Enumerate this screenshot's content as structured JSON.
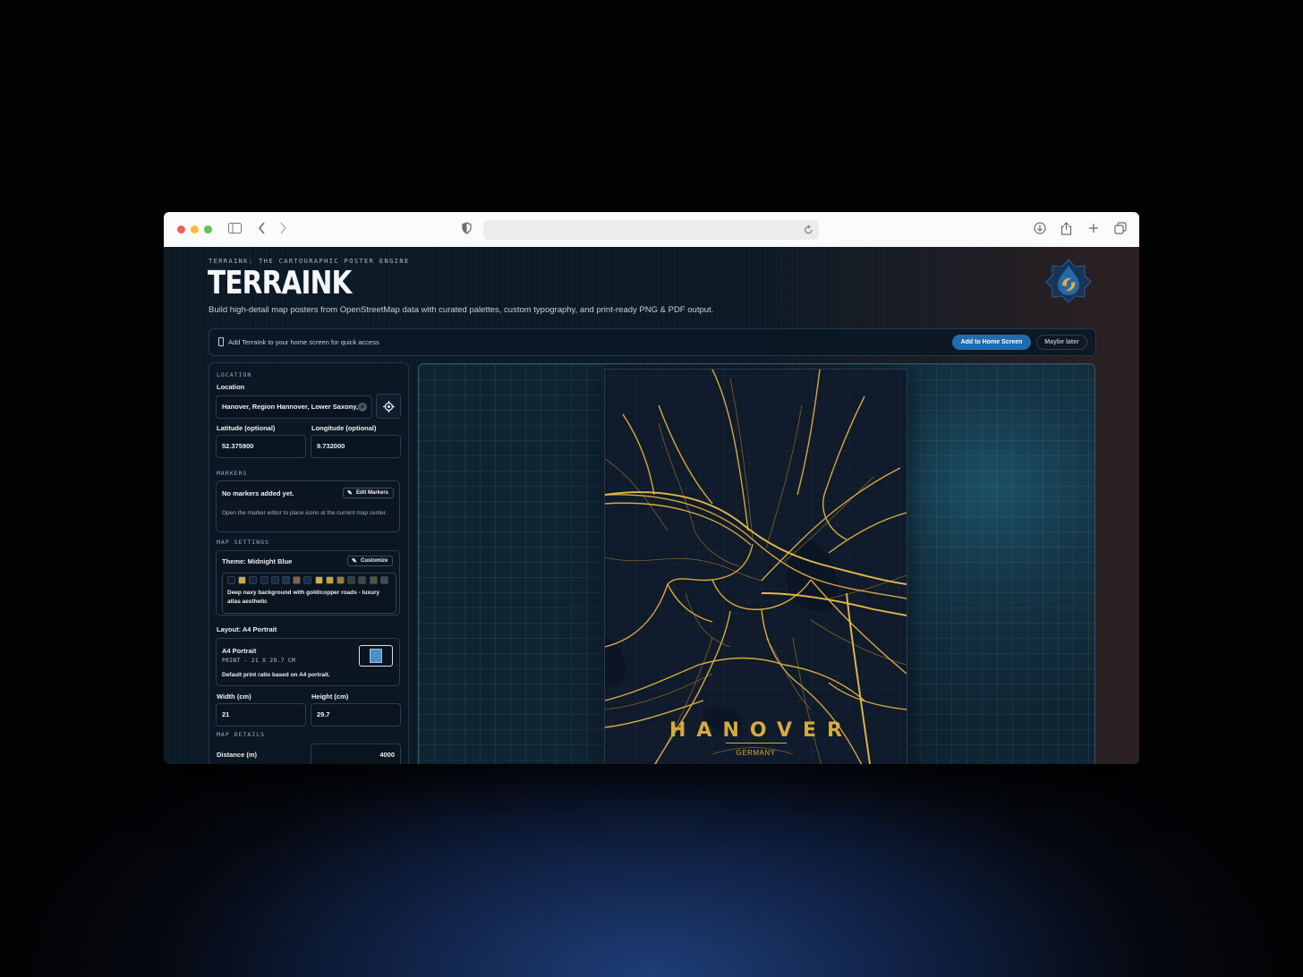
{
  "app": {
    "eyebrow": "TERRAINK: THE CARTOGRAPHIC POSTER ENGINE",
    "title": "TERRAINK",
    "subtitle": "Build high-detail map posters from OpenStreetMap data with curated palettes, custom typography, and print-ready PNG & PDF output."
  },
  "pwa_banner": {
    "text": "Add TerraInk to your home screen for quick access",
    "primary_label": "Add to Home Screen",
    "secondary_label": "Maybe later"
  },
  "location": {
    "section": "LOCATION",
    "label": "Location",
    "value": "Hanover, Region Hannover, Lower Saxony,",
    "clear_symbol": "×",
    "lat_label": "Latitude (optional)",
    "lat_value": "52.375900",
    "lon_label": "Longitude (optional)",
    "lon_value": "9.732000"
  },
  "markers": {
    "section": "MARKERS",
    "empty_text": "No markers added yet.",
    "edit_label": "Edit Markers",
    "hint": "Open the marker editor to place icons at the current map center."
  },
  "map_settings": {
    "section": "MAP SETTINGS",
    "theme_label": "Theme: Midnight Blue",
    "customize_label": "Customize",
    "palette": [
      "#0f1a2a",
      "#d4a93e",
      "#14233a",
      "#16263d",
      "#182a44",
      "#1e3148",
      "#7d6640",
      "#1b2d44",
      "#d8ad48",
      "#caa040",
      "#9f7d3a",
      "#3a3a38",
      "#4a4538",
      "#5c5238",
      "#3e4a50"
    ],
    "theme_description": "Deep navy background with gold/copper roads - luxury atlas aesthetic"
  },
  "layout": {
    "label": "Layout: A4 Portrait",
    "card_title": "A4 Portrait",
    "card_sub": "PRINT - 21 X 29.7 CM",
    "card_desc": "Default print ratio based on A4 portrait.",
    "width_label": "Width (cm)",
    "width_value": "21",
    "height_label": "Height (cm)",
    "height_value": "29.7"
  },
  "map_details": {
    "section": "MAP DETAILS",
    "distance_label": "Distance (m)",
    "distance_value": "4000"
  },
  "poster": {
    "city": "HANOVER",
    "country": "GERMANY",
    "road_color": "#d8a93e",
    "background_color": "#0f1a2a"
  },
  "colors": {
    "accent": "#1f6dae",
    "gold": "#d8a93e"
  }
}
